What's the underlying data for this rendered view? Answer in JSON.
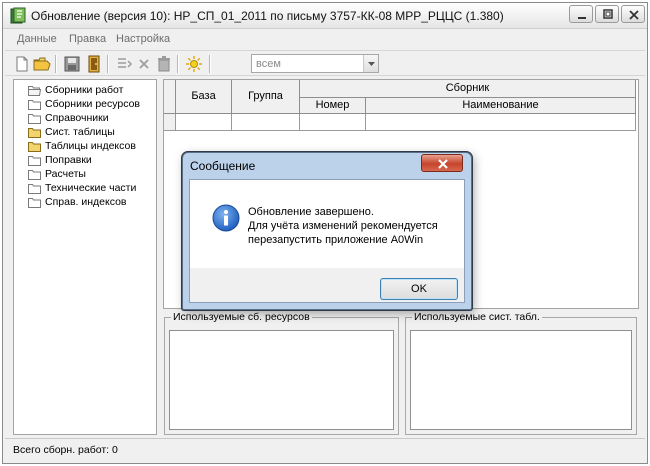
{
  "window": {
    "title": "Обновление (версия 10): НР_СП_01_2011 по письму 3757-КК-08 МРР_РЦЦС (1.380)",
    "icon": "app-icon"
  },
  "menu": {
    "items": [
      "Данные",
      "Правка",
      "Настройка"
    ]
  },
  "toolbar": {
    "icons": [
      "new-icon",
      "open-folder-icon",
      "save-icon",
      "exit-door-icon",
      "insert-row-icon",
      "delete-x-icon",
      "trash-icon",
      "sun-icon"
    ],
    "filter_value": "всем"
  },
  "tree": {
    "items": [
      {
        "label": "Сборники работ"
      },
      {
        "label": "Сборники ресурсов"
      },
      {
        "label": "Справочники"
      },
      {
        "label": "Сист. таблицы"
      },
      {
        "label": "Таблицы индексов"
      },
      {
        "label": "Поправки"
      },
      {
        "label": "Расчеты"
      },
      {
        "label": "Технические части"
      },
      {
        "label": "Справ. индексов"
      }
    ]
  },
  "grid": {
    "headers": {
      "baza": "База",
      "gruppa": "Группа",
      "sbornik": "Сборник",
      "nomer": "Номер",
      "naimenovanie": "Наименование"
    }
  },
  "panels": {
    "left_legend": "Используемые сб. ресурсов",
    "right_legend": "Используемые сист. табл."
  },
  "status": {
    "text": "Всего сборн. работ: 0"
  },
  "dialog": {
    "title": "Сообщение",
    "line1": "Обновление завершено.",
    "line2": "Для учёта изменений рекомендуется",
    "line3": "перезапустить приложение A0Win",
    "ok_label": "OK"
  },
  "colors": {
    "dialog_frame": "#bcd2ea",
    "close_button": "#c5452c",
    "info_icon": "#1f5fbf",
    "window_bg": "#f0f0f0"
  }
}
